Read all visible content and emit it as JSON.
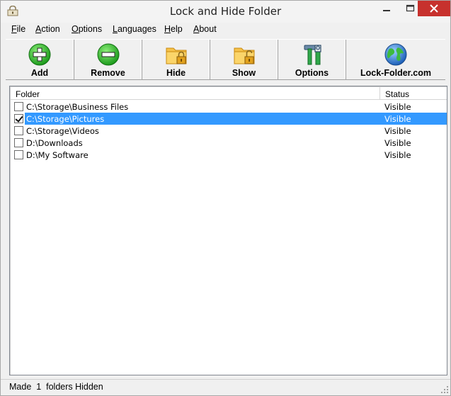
{
  "window": {
    "title": "Lock and Hide Folder",
    "close_color": "#c7312d"
  },
  "menu": {
    "items": [
      {
        "label": "File"
      },
      {
        "label": "Action"
      },
      {
        "label": "Options"
      },
      {
        "label": "Languages"
      },
      {
        "label": "Help"
      },
      {
        "label": "About"
      }
    ]
  },
  "toolbar": {
    "buttons": [
      {
        "label": "Add",
        "icon": "add-icon"
      },
      {
        "label": "Remove",
        "icon": "remove-icon"
      },
      {
        "label": "Hide",
        "icon": "folder-lock-icon"
      },
      {
        "label": "Show",
        "icon": "folder-unlock-icon"
      },
      {
        "label": "Options",
        "icon": "tools-icon"
      },
      {
        "label": "Lock-Folder.com",
        "icon": "globe-icon"
      }
    ]
  },
  "list": {
    "columns": {
      "folder": "Folder",
      "status": "Status"
    },
    "rows": [
      {
        "folder": "C:\\Storage\\Business Files",
        "status": "Visible",
        "checked": false,
        "selected": false
      },
      {
        "folder": "C:\\Storage\\Pictures",
        "status": "Visible",
        "checked": true,
        "selected": true
      },
      {
        "folder": "C:\\Storage\\Videos",
        "status": "Visible",
        "checked": false,
        "selected": false
      },
      {
        "folder": "D:\\Downloads",
        "status": "Visible",
        "checked": false,
        "selected": false
      },
      {
        "folder": "D:\\My Software",
        "status": "Visible",
        "checked": false,
        "selected": false
      }
    ],
    "selection_color": "#3399ff"
  },
  "statusbar": {
    "text": "Made  1  folders Hidden"
  }
}
